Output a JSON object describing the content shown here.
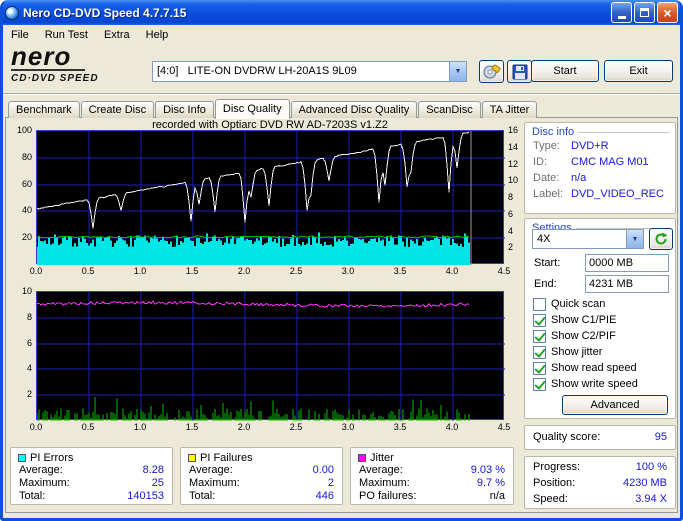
{
  "window": {
    "title": "Nero CD-DVD Speed 4.7.7.15"
  },
  "icons": {
    "close_glyph": "×",
    "dropdown_glyph": "▼"
  },
  "colors": {
    "value_text": "#1717d6",
    "pie_cyan": "#00e5e5",
    "pif_yellow": "#ffff00",
    "jitter_magenta": "#ff30ff",
    "write_speed_green": "#00bb00",
    "read_speed_white": "#f2f2f2",
    "grid_blue": "#2020bb"
  },
  "menu": {
    "items": [
      {
        "label": "File"
      },
      {
        "label": "Run Test"
      },
      {
        "label": "Extra"
      },
      {
        "label": "Help"
      }
    ]
  },
  "logo": {
    "line1": "nero",
    "line2": "CD·DVD SPEED"
  },
  "toolbar": {
    "drive_select": "[4:0]   LITE-ON DVDRW LH-20A1S 9L09",
    "start_label": "Start",
    "exit_label": "Exit"
  },
  "tabs": [
    {
      "label": "Benchmark",
      "active": false
    },
    {
      "label": "Create Disc",
      "active": false
    },
    {
      "label": "Disc Info",
      "active": false
    },
    {
      "label": "Disc Quality",
      "active": true
    },
    {
      "label": "Advanced Disc Quality",
      "active": false
    },
    {
      "label": "ScanDisc",
      "active": false
    },
    {
      "label": "TA Jitter",
      "active": false
    }
  ],
  "graph_header": "recorded with Optiarc DVD RW AD-7203S  v1.Z2",
  "disc_info": {
    "title": "Disc info",
    "rows": [
      {
        "label": "Type:",
        "value": "DVD+R"
      },
      {
        "label": "ID:",
        "value": "CMC MAG M01"
      },
      {
        "label": "Date:",
        "value": "n/a"
      },
      {
        "label": "Label:",
        "value": "DVD_VIDEO_REC"
      }
    ]
  },
  "settings": {
    "title": "Settings",
    "speed": "4X",
    "start_label": "Start:",
    "start_value": "0000 MB",
    "end_label": "End:",
    "end_value": "4231 MB",
    "checkboxes": [
      {
        "label": "Quick scan",
        "checked": false
      },
      {
        "label": "Show C1/PIE",
        "checked": true
      },
      {
        "label": "Show C2/PIF",
        "checked": true
      },
      {
        "label": "Show jitter",
        "checked": true
      },
      {
        "label": "Show read speed",
        "checked": true
      },
      {
        "label": "Show write speed",
        "checked": true
      }
    ],
    "advanced_label": "Advanced"
  },
  "quality": {
    "label": "Quality score:",
    "value": "95"
  },
  "progress_panel": {
    "rows": [
      {
        "label": "Progress:",
        "value": "100 %"
      },
      {
        "label": "Position:",
        "value": "4230 MB"
      },
      {
        "label": "Speed:",
        "value": "3.94 X"
      }
    ]
  },
  "stat_panels": [
    {
      "title": "PI Errors",
      "color": "#00ffff",
      "rows": [
        [
          "Average:",
          "8.28"
        ],
        [
          "Maximum:",
          "25"
        ],
        [
          "Total:",
          "140153"
        ]
      ]
    },
    {
      "title": "PI Failures",
      "color": "#ffff00",
      "rows": [
        [
          "Average:",
          "0.00"
        ],
        [
          "Maximum:",
          "2"
        ],
        [
          "Total:",
          "446"
        ]
      ]
    },
    {
      "title": "Jitter",
      "color": "#ff00ff",
      "rows": [
        [
          "Average:",
          "9.03 %"
        ],
        [
          "Maximum:",
          "9.7 %"
        ],
        [
          "PO failures:",
          "n/a"
        ]
      ]
    }
  ],
  "chart_data": [
    {
      "type": "area",
      "name": "pie-speed",
      "x_range": [
        0,
        4.5
      ],
      "data_end_x": 4.17,
      "end_line": true,
      "x_ticks": [
        "0.0",
        "0.5",
        "1.0",
        "1.5",
        "2.0",
        "2.5",
        "3.0",
        "3.5",
        "4.0",
        "4.5"
      ],
      "left_ticks": [
        100,
        80,
        60,
        40,
        20
      ],
      "left_range": [
        0,
        100
      ],
      "right_ticks": [
        16,
        14,
        12,
        10,
        8,
        6,
        4,
        2
      ],
      "right_range": [
        0,
        16
      ],
      "grid_color": "#2020bb",
      "bg": "#000000",
      "series": [
        {
          "name": "pi-errors-noise",
          "type": "noise-area",
          "color": "#00e5e5",
          "min": 9,
          "max": 22,
          "seed": 7
        },
        {
          "name": "write-speed",
          "type": "hline",
          "color": "#00bb00",
          "value": 21,
          "seed": 13
        },
        {
          "name": "read-speed",
          "type": "ramp",
          "color": "#f2f2f2",
          "start": 42,
          "end": 99,
          "seed": 3,
          "dips": [
            [
              0.54,
              22
            ],
            [
              0.8,
              12
            ],
            [
              1.49,
              30
            ],
            [
              1.55,
              18
            ],
            [
              1.72,
              26
            ],
            [
              2.0,
              38
            ],
            [
              2.06,
              20
            ],
            [
              2.24,
              28
            ],
            [
              2.59,
              34
            ],
            [
              2.64,
              22
            ],
            [
              2.81,
              18
            ],
            [
              3.28,
              40
            ],
            [
              3.34,
              28
            ],
            [
              3.55,
              30
            ],
            [
              3.59,
              18
            ],
            [
              3.97,
              42
            ],
            [
              4.03,
              25
            ]
          ]
        }
      ]
    },
    {
      "type": "line",
      "name": "jitter-pif",
      "x_range": [
        0,
        4.5
      ],
      "data_end_x": 4.17,
      "end_line": false,
      "x_ticks": [
        "0.0",
        "0.5",
        "1.0",
        "1.5",
        "2.0",
        "2.5",
        "3.0",
        "3.5",
        "4.0",
        "4.5"
      ],
      "left_ticks": [
        10,
        8,
        6,
        4,
        2
      ],
      "left_range": [
        0,
        10
      ],
      "grid_color": "#2020bb",
      "bg": "#000000",
      "series": [
        {
          "name": "pi-failures-spikes",
          "type": "spikes",
          "color": "#00bb00",
          "seed": 11,
          "max": 2
        },
        {
          "name": "jitter-line",
          "type": "noisy-hline",
          "color": "#ff30ff",
          "value": 9.05,
          "noise": 0.12,
          "seed": 5
        }
      ]
    }
  ]
}
